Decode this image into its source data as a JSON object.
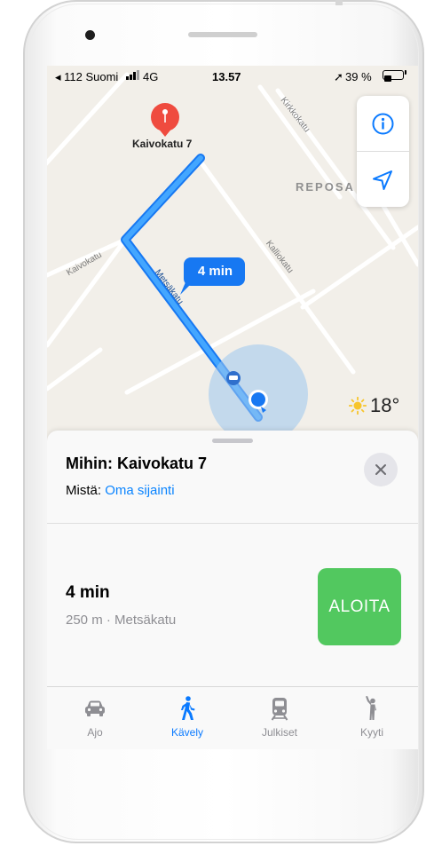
{
  "status_bar": {
    "carrier": "◂ 112 Suomi",
    "network": "4G",
    "time": "13.57",
    "battery": "39 %",
    "battery_level": 0.39
  },
  "map": {
    "destination_pin_label": "Kaivokatu 7",
    "eta_bubble": "4 min",
    "district_label": "REPOSA",
    "streets": {
      "kirkkokatu": "Kirkkokatu",
      "kaivokatu": "Kaivokatu",
      "kalliokatu": "Kalliokatu",
      "metsakatu": "Metsäkatu"
    },
    "route_color": "#1e90ff",
    "pin_color": "#ef4b3f"
  },
  "controls": {
    "info_icon": "info-icon",
    "location_icon": "location-arrow-icon"
  },
  "weather": {
    "icon": "sun-icon",
    "temperature": "18°"
  },
  "card": {
    "destination": "Mihin: Kaivokatu 7",
    "from_label": "Mistä:",
    "from_value": "Oma sijainti",
    "close_icon": "close-icon",
    "route_time": "4 min",
    "route_details": "250 m · Metsäkatu",
    "start_button": "ALOITA",
    "start_color": "#52c85f"
  },
  "tabs": [
    {
      "label": "Ajo",
      "icon": "car-icon",
      "active": false
    },
    {
      "label": "Kävely",
      "icon": "walking-icon",
      "active": true
    },
    {
      "label": "Julkiset",
      "icon": "train-icon",
      "active": false
    },
    {
      "label": "Kyyti",
      "icon": "rideshare-icon",
      "active": false
    }
  ]
}
